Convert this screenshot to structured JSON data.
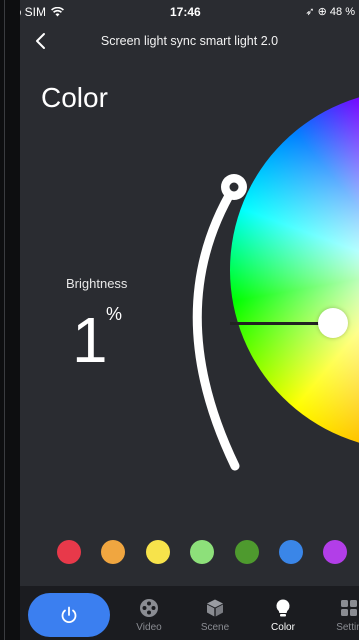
{
  "status_bar": {
    "carrier": "No SIM",
    "time": "17:46",
    "battery": "48 %"
  },
  "header": {
    "title": "Screen light sync smart light 2.0",
    "back_icon": "chevron-left-icon"
  },
  "page": {
    "title": "Color"
  },
  "brightness": {
    "label": "Brightness",
    "value": "1",
    "unit": "%"
  },
  "swatches": [
    {
      "name": "red",
      "color": "#e8394a"
    },
    {
      "name": "orange",
      "color": "#f0a640"
    },
    {
      "name": "yellow",
      "color": "#f7e34b"
    },
    {
      "name": "light-green",
      "color": "#8de07a"
    },
    {
      "name": "green",
      "color": "#4e9a2e"
    },
    {
      "name": "blue",
      "color": "#3a86e8"
    },
    {
      "name": "purple",
      "color": "#b23ee8"
    }
  ],
  "tabs": [
    {
      "label": "Video",
      "icon": "film-reel-icon",
      "active": false
    },
    {
      "label": "Scene",
      "icon": "cube-icon",
      "active": false
    },
    {
      "label": "Color",
      "icon": "bulb-icon",
      "active": true
    },
    {
      "label": "Settin",
      "icon": "grid-icon",
      "active": false
    }
  ],
  "accent": "#3b7ff0"
}
